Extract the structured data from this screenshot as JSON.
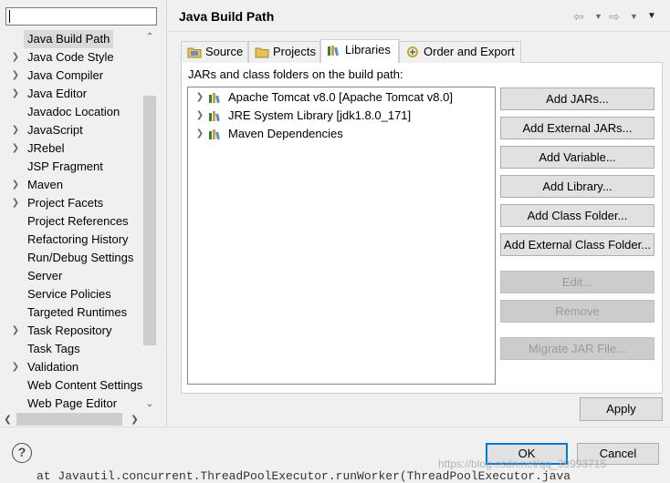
{
  "colors": {
    "accent": "#0078d7",
    "selection": "#d9d9d9",
    "button_face": "#e1e1e1",
    "disabled_text": "#9a9a9a"
  },
  "sidebar": {
    "filter_value": "",
    "items": [
      {
        "label": "Java Build Path",
        "expandable": false,
        "selected": true
      },
      {
        "label": "Java Code Style",
        "expandable": true
      },
      {
        "label": "Java Compiler",
        "expandable": true
      },
      {
        "label": "Java Editor",
        "expandable": true
      },
      {
        "label": "Javadoc Location",
        "expandable": false
      },
      {
        "label": "JavaScript",
        "expandable": true
      },
      {
        "label": "JRebel",
        "expandable": true
      },
      {
        "label": "JSP Fragment",
        "expandable": false
      },
      {
        "label": "Maven",
        "expandable": true
      },
      {
        "label": "Project Facets",
        "expandable": true
      },
      {
        "label": "Project References",
        "expandable": false
      },
      {
        "label": "Refactoring History",
        "expandable": false
      },
      {
        "label": "Run/Debug Settings",
        "expandable": false
      },
      {
        "label": "Server",
        "expandable": false
      },
      {
        "label": "Service Policies",
        "expandable": false
      },
      {
        "label": "Targeted Runtimes",
        "expandable": false
      },
      {
        "label": "Task Repository",
        "expandable": true
      },
      {
        "label": "Task Tags",
        "expandable": false
      },
      {
        "label": "Validation",
        "expandable": true
      },
      {
        "label": "Web Content Settings",
        "expandable": false
      },
      {
        "label": "Web Page Editor",
        "expandable": false
      }
    ]
  },
  "header": {
    "title": "Java Build Path"
  },
  "tabs": [
    {
      "label": "Source",
      "icon": "source-folder-icon",
      "active": false
    },
    {
      "label": "Projects",
      "icon": "projects-folder-icon",
      "active": false
    },
    {
      "label": "Libraries",
      "icon": "libraries-icon",
      "active": true
    },
    {
      "label": "Order and Export",
      "icon": "order-export-icon",
      "active": false
    }
  ],
  "libraries": {
    "caption": "JARs and class folders on the build path:",
    "entries": [
      {
        "label": "Apache Tomcat v8.0 [Apache Tomcat v8.0]",
        "icon": "library-icon"
      },
      {
        "label": "JRE System Library [jdk1.8.0_171]",
        "icon": "library-icon"
      },
      {
        "label": "Maven Dependencies",
        "icon": "library-icon"
      }
    ]
  },
  "buttons": {
    "add_jars": {
      "label": "Add JARs...",
      "enabled": true
    },
    "add_external_jars": {
      "label": "Add External JARs...",
      "enabled": true
    },
    "add_variable": {
      "label": "Add Variable...",
      "enabled": true
    },
    "add_library": {
      "label": "Add Library...",
      "enabled": true
    },
    "add_class_folder": {
      "label": "Add Class Folder...",
      "enabled": true
    },
    "add_external_class_folder": {
      "label": "Add External Class Folder...",
      "enabled": true
    },
    "edit": {
      "label": "Edit...",
      "enabled": false
    },
    "remove": {
      "label": "Remove",
      "enabled": false
    },
    "migrate_jar": {
      "label": "Migrate JAR File...",
      "enabled": false
    },
    "apply": {
      "label": "Apply",
      "enabled": true
    }
  },
  "footer": {
    "help_glyph": "?",
    "ok_label": "OK",
    "cancel_label": "Cancel",
    "watermark": "https://blog.csdn.net/qq_39993715",
    "background_code": "at  Javautil.concurrent.ThreadPoolExecutor.runWorker(ThreadPoolExecutor.java"
  }
}
